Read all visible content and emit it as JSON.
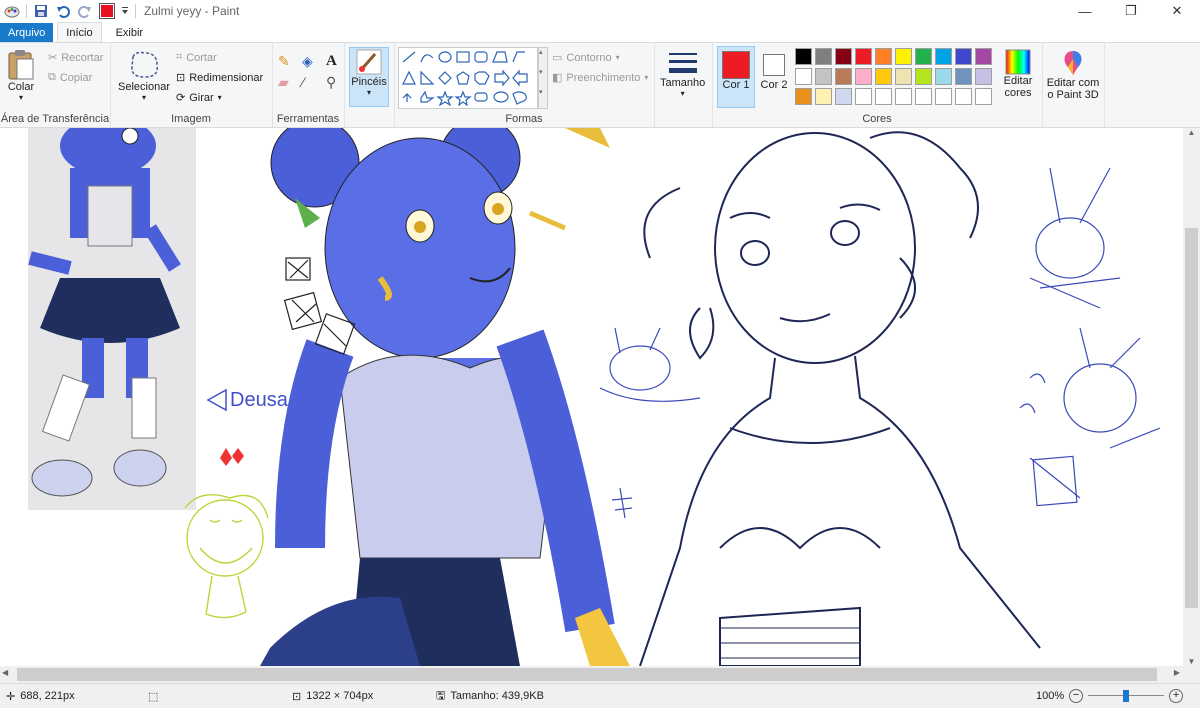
{
  "window": {
    "title": "Zulmi yeyy - Paint",
    "min_icon": "minimize-icon",
    "max_icon": "restore-icon",
    "close_icon": "close-icon"
  },
  "quick_access": {
    "color": "#e81123"
  },
  "tabs": [
    {
      "label": "Arquivo"
    },
    {
      "label": "Início"
    },
    {
      "label": "Exibir"
    }
  ],
  "ribbon": {
    "clipboard": {
      "label": "Área de Transferência",
      "paste": "Colar",
      "cut": "Recortar",
      "copy": "Copiar"
    },
    "image": {
      "label": "Imagem",
      "select": "Selecionar",
      "crop": "Cortar",
      "resize": "Redimensionar",
      "rotate": "Girar"
    },
    "tools": {
      "label": "Ferramentas"
    },
    "brushes": {
      "label": "Pincéis"
    },
    "shapes": {
      "label": "Formas",
      "outline": "Contorno",
      "fill": "Preenchimento"
    },
    "size": {
      "label": "Tamanho"
    },
    "colors": {
      "label": "Cores",
      "color1": "Cor 1",
      "color1_value": "1",
      "color1_hex": "#ed1c24",
      "color2": "Cor 2",
      "color2_value": "2",
      "color2_hex": "#ffffff",
      "edit_colors": "Editar cores",
      "palette": [
        "#000000",
        "#7f7f7f",
        "#880015",
        "#ed1c24",
        "#ff7f27",
        "#fff200",
        "#22b14c",
        "#00a2e8",
        "#3f48cc",
        "#a349a4",
        "#ffffff",
        "#c3c3c3",
        "#b97a57",
        "#ffaec9",
        "#ffc90e",
        "#efe4b0",
        "#b5e61d",
        "#99d9ea",
        "#7092be",
        "#c8bfe7",
        "#e8901c",
        "#fff2b0",
        "#d0d8f0",
        "#ffffff",
        "#ffffff",
        "#ffffff",
        "#ffffff",
        "#ffffff",
        "#ffffff",
        "#ffffff"
      ]
    },
    "paint3d": {
      "label": "Editar com o Paint 3D"
    }
  },
  "canvas": {
    "handwritten_note": "Deusa"
  },
  "status": {
    "cursor_pos": "688, 221px",
    "image_size": "1322 × 704px",
    "file_size": "Tamanho: 439,9KB",
    "zoom": "100%",
    "zoom_level": 0.5
  }
}
